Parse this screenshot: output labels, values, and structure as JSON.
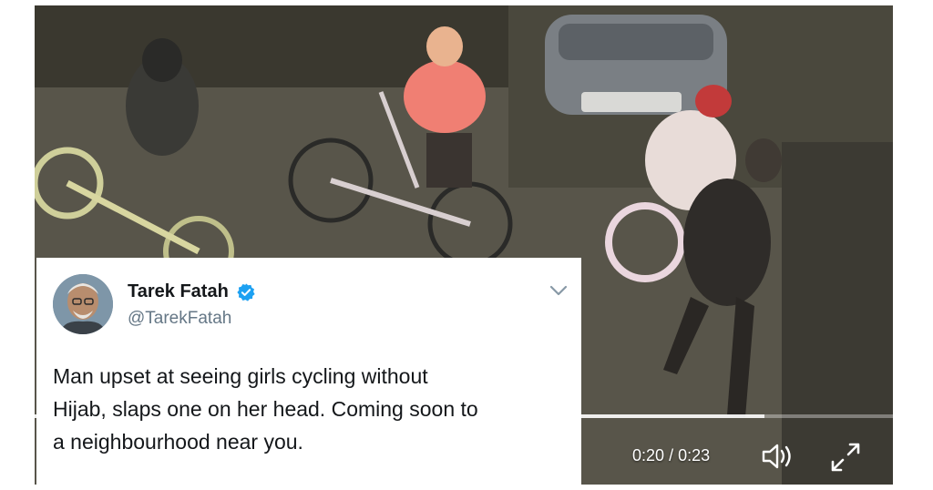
{
  "video": {
    "current_time": "0:20",
    "separator": "/",
    "duration": "0:23",
    "progress_fraction": 0.85,
    "controls": {
      "play_icon": "play-icon",
      "volume_icon": "volume-icon",
      "fullscreen_icon": "fullscreen-icon"
    }
  },
  "tweet": {
    "author_name": "Tarek Fatah",
    "handle": "@TarekFatah",
    "verified_icon": "verified-badge-icon",
    "menu_icon": "chevron-down-icon",
    "text_lines": [
      "Man upset at seeing girls cycling without",
      "Hijab, slaps one on her head. Coming soon to",
      "a neighbourhood near you."
    ]
  },
  "colors": {
    "verified_blue": "#1da1f2",
    "text_dark": "#14171a",
    "handle_gray": "#657786"
  }
}
